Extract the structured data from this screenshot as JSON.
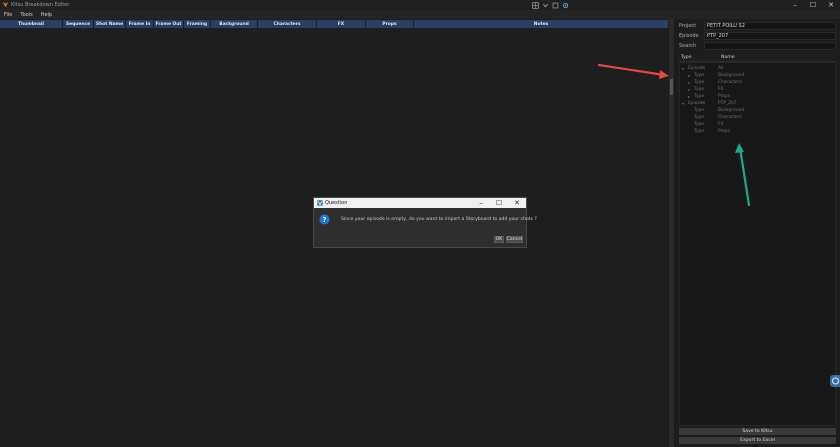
{
  "window": {
    "title": "Kitsu Breakdown Editor",
    "icons": [
      "kitsu-logo-icon",
      "grid-tool-icon",
      "chevron-tool-icon",
      "color-picker-icon",
      "record-icon"
    ]
  },
  "menu": [
    "File",
    "Tools",
    "Help"
  ],
  "table": {
    "columns": [
      "Thumbnail",
      "Sequence",
      "Shot Name",
      "Frame In",
      "Frame Out",
      "Framing",
      "Background",
      "Characters",
      "FX",
      "Props",
      "Notes"
    ]
  },
  "sidebar": {
    "project_label": "Project",
    "project_value": "PETIT POILU S2",
    "episode_label": "Episode",
    "episode_value": "PTP_207",
    "search_label": "Search",
    "search_value": "",
    "tree_headers": {
      "type": "Type",
      "name": "Name"
    },
    "tree": [
      {
        "type": "Episode",
        "name": "All",
        "level": 0,
        "arrow": "▾"
      },
      {
        "type": "Type",
        "name": "Background",
        "level": 1,
        "arrow": "▸"
      },
      {
        "type": "Type",
        "name": "Characters",
        "level": 1,
        "arrow": "▸"
      },
      {
        "type": "Type",
        "name": "FX",
        "level": 1,
        "arrow": "▸"
      },
      {
        "type": "Type",
        "name": "Props",
        "level": 1,
        "arrow": "▸"
      },
      {
        "type": "Episode",
        "name": "PTP_207",
        "level": 0,
        "arrow": "▾"
      },
      {
        "type": "Type",
        "name": "Background",
        "level": 1,
        "arrow": ""
      },
      {
        "type": "Type",
        "name": "Characters",
        "level": 1,
        "arrow": ""
      },
      {
        "type": "Type",
        "name": "FX",
        "level": 1,
        "arrow": ""
      },
      {
        "type": "Type",
        "name": "Props",
        "level": 1,
        "arrow": ""
      }
    ],
    "save_button": "Save to Kitsu",
    "export_button": "Export to Excel"
  },
  "dialog": {
    "title": "Question",
    "message": "Since your episode is empty, do you want to import a Storyboard to add your shots ?",
    "ok": "OK",
    "cancel": "Cancel"
  },
  "colors": {
    "header_bar": "#2c3e63",
    "red_arrow": "#e04848",
    "teal_arrow": "#1fa98a",
    "question_icon": "#1e78d2"
  }
}
